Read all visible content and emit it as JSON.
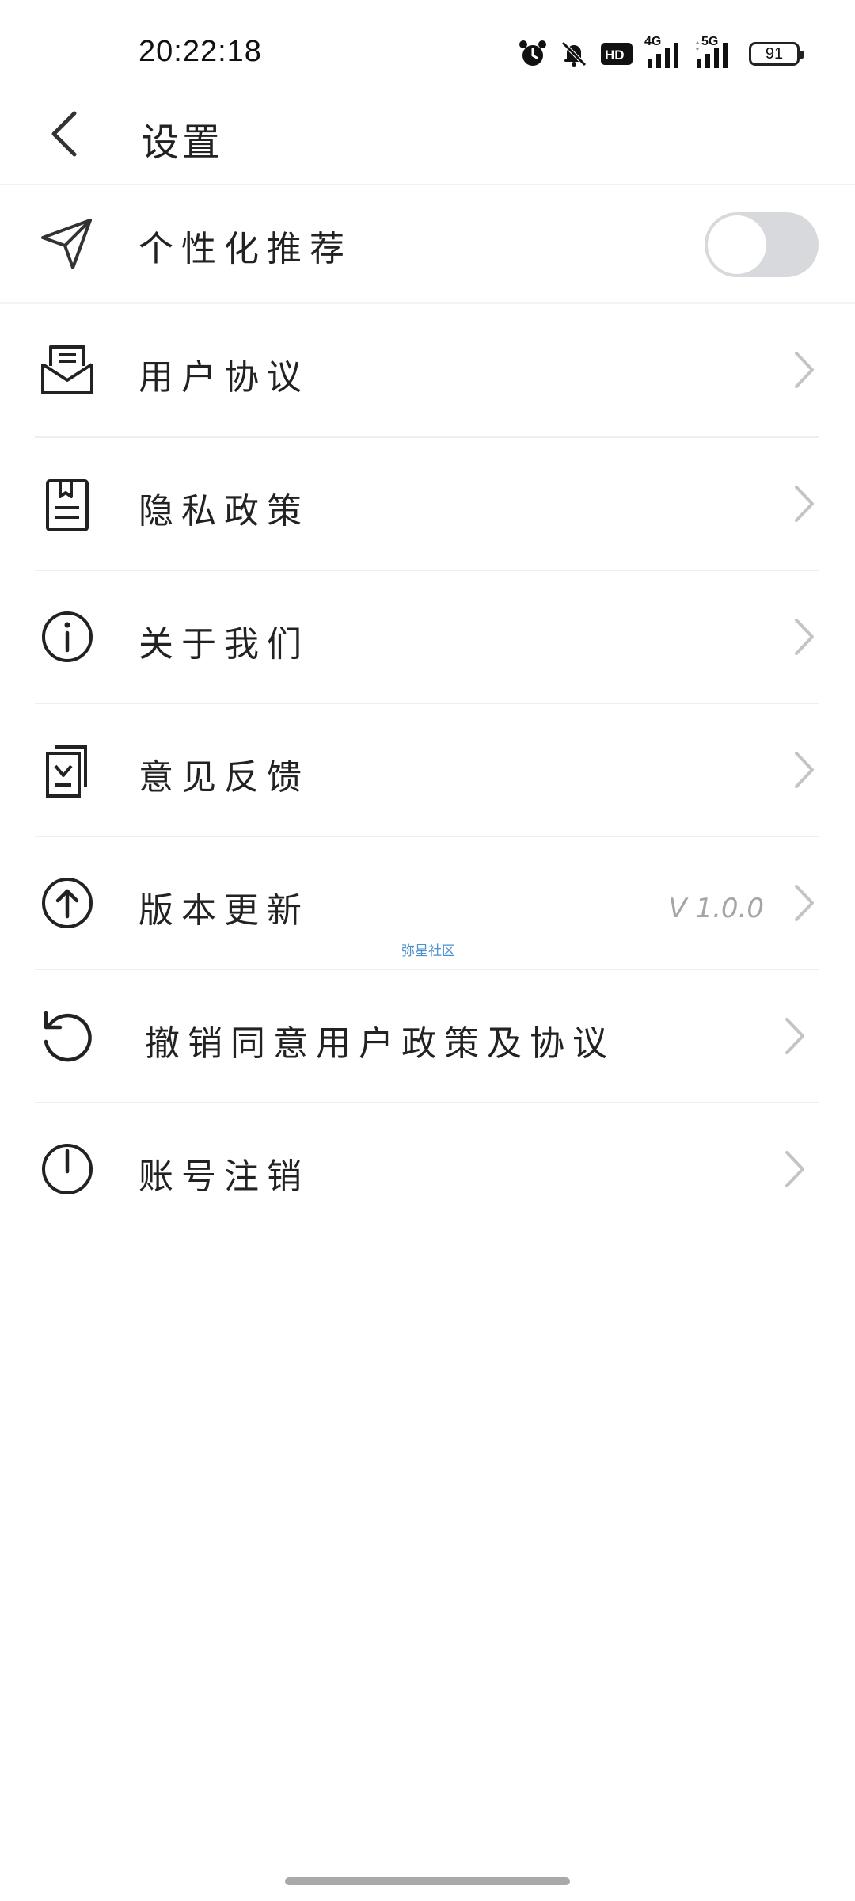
{
  "status_bar": {
    "time": "20:22:18",
    "network_4g": "4G",
    "network_5g": "5G",
    "hd_badge": "HD",
    "battery": "91",
    "icons": [
      "alarm-icon",
      "bell-off-icon",
      "hd-icon",
      "signal-4g-icon",
      "signal-5g-icon",
      "battery-icon"
    ]
  },
  "header": {
    "title": "设置",
    "back_icon": "chevron-left-icon"
  },
  "settings": {
    "personalized": {
      "label": "个性化推荐",
      "icon": "send-icon",
      "enabled": false
    },
    "items": [
      {
        "label": "用户协议",
        "icon": "envelope-icon"
      },
      {
        "label": "隐私政策",
        "icon": "document-bookmark-icon"
      },
      {
        "label": "关于我们",
        "icon": "info-icon"
      },
      {
        "label": "意见反馈",
        "icon": "feedback-icon"
      },
      {
        "label": "版本更新",
        "icon": "upload-circle-icon",
        "value": "V 1.0.0"
      },
      {
        "label": "撤销同意用户政策及协议",
        "icon": "revoke-icon"
      },
      {
        "label": "账号注销",
        "icon": "power-icon"
      }
    ]
  },
  "watermark": "弥星社区",
  "colors": {
    "text": "#222222",
    "divider": "#eeeeee",
    "chevron": "#c4c4c4",
    "toggle_off": "#d8d9dd",
    "version_text": "#a5a5a5",
    "watermark": "#4d90d0"
  }
}
